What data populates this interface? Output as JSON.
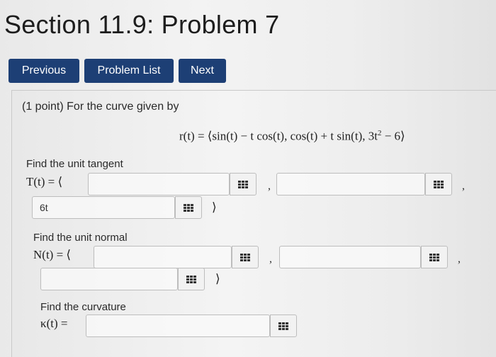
{
  "header": {
    "title": "Section 11.9: Problem 7"
  },
  "nav": {
    "previous": "Previous",
    "problem_list": "Problem List",
    "next": "Next"
  },
  "problem": {
    "statement": "(1 point) For the curve given by",
    "equation": {
      "lhs": "r(t) = ⟨sin(t) − t cos(t), cos(t) + t sin(t), 3t",
      "exponent": "2",
      "rhs": " − 6⟩"
    },
    "tangent": {
      "label": "Find the unit tangent",
      "math": "T(t) = ⟨",
      "field1_value": "",
      "field2_value": "",
      "field3_value": "6t",
      "close": "⟩"
    },
    "normal": {
      "label": "Find the unit normal",
      "math": "N(t) = ⟨",
      "field1_value": "",
      "field2_value": "",
      "field3_value": "",
      "close": "⟩"
    },
    "curvature": {
      "label": "Find the curvature",
      "math": "κ(t) =",
      "field_value": ""
    },
    "separator": ","
  },
  "icons": {
    "equation_editor": "grid-icon"
  }
}
